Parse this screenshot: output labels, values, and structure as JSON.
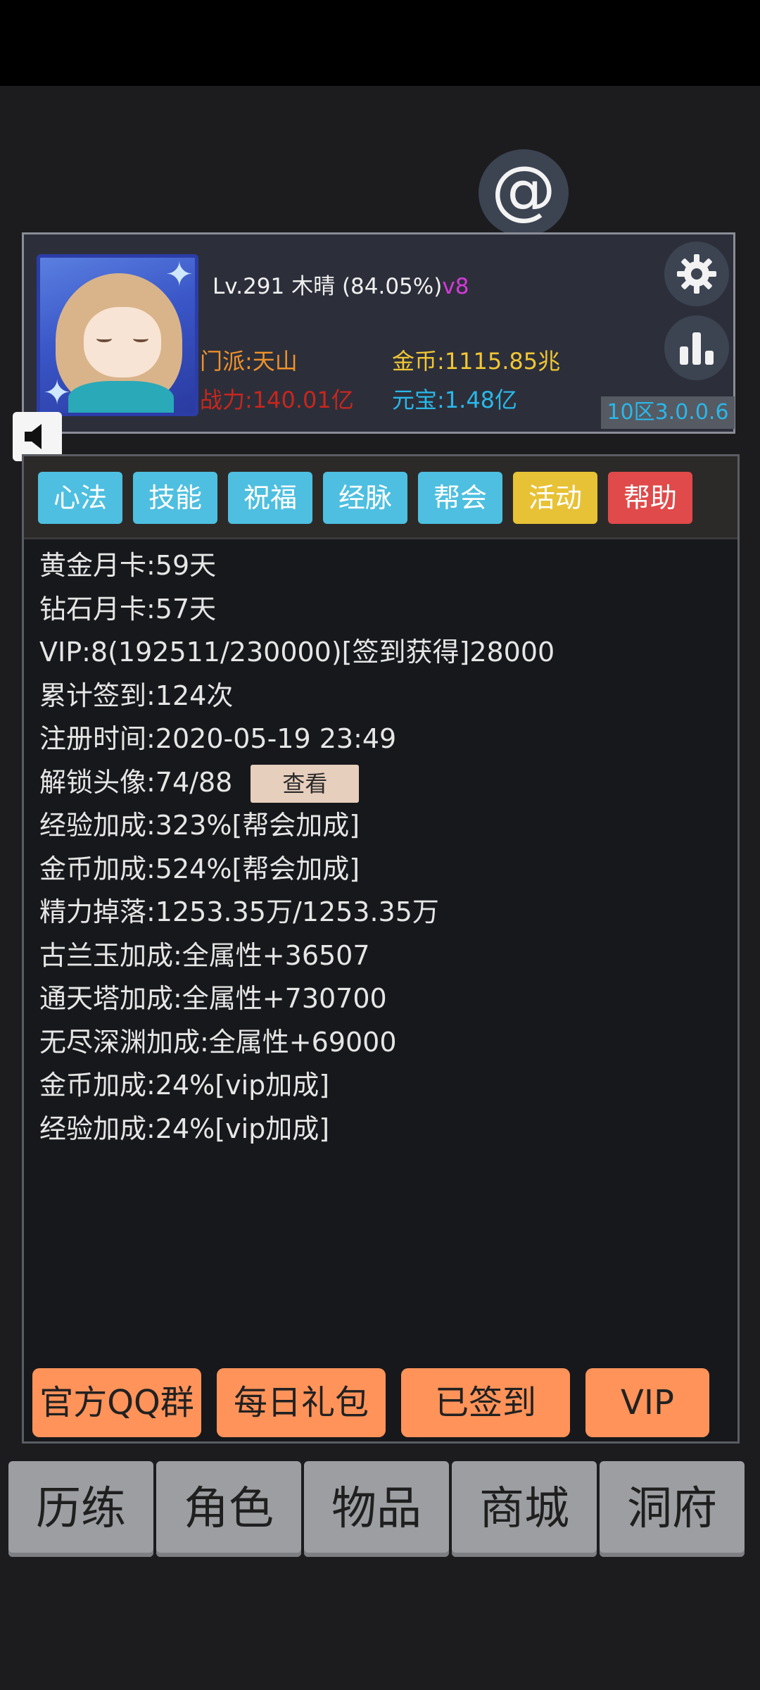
{
  "profile": {
    "level_line": "Lv.291 木晴 (84.05%)",
    "vip_badge": "v8",
    "sect": "门派:天山",
    "gold": "金币:1115.85兆",
    "power": "战力:140.01亿",
    "ingot": "元宝:1.48亿",
    "server": "10区3.0.0.6"
  },
  "tabs": [
    {
      "label": "心法",
      "color": "#4ebfe0"
    },
    {
      "label": "技能",
      "color": "#4ebfe0"
    },
    {
      "label": "祝福",
      "color": "#4ebfe0"
    },
    {
      "label": "经脉",
      "color": "#4ebfe0"
    },
    {
      "label": "帮会",
      "color": "#4ebfe0"
    },
    {
      "label": "活动",
      "color": "#e8c236"
    },
    {
      "label": "帮助",
      "color": "#e04a4a"
    }
  ],
  "info": {
    "line1": "黄金月卡:59天",
    "line2": "钻石月卡:57天",
    "line3": "VIP:8(192511/230000)[签到获得]28000",
    "line4": "累计签到:124次",
    "line5": "注册时间:2020-05-19 23:49",
    "line6": "解锁头像:74/88",
    "view_button": "查看",
    "line7": "经验加成:323%[帮会加成]",
    "line8": "金币加成:524%[帮会加成]",
    "line9": "精力掉落:1253.35万/1253.35万",
    "line10": "古兰玉加成:全属性+36507",
    "line11": "通天塔加成:全属性+730700",
    "line12": "无尽深渊加成:全属性+69000",
    "line13": "金币加成:24%[vip加成]",
    "line14": "经验加成:24%[vip加成]"
  },
  "actions": {
    "qq_group": "官方QQ群",
    "daily_gift": "每日礼包",
    "signed_in": "已签到",
    "vip": "VIP"
  },
  "nav": {
    "n1": "历练",
    "n2": "角色",
    "n3": "物品",
    "n4": "商城",
    "n5": "洞府"
  },
  "icons": {
    "at": "at-icon",
    "settings": "gear-icon",
    "rank": "bar-chart-icon",
    "sound": "speaker-icon"
  }
}
